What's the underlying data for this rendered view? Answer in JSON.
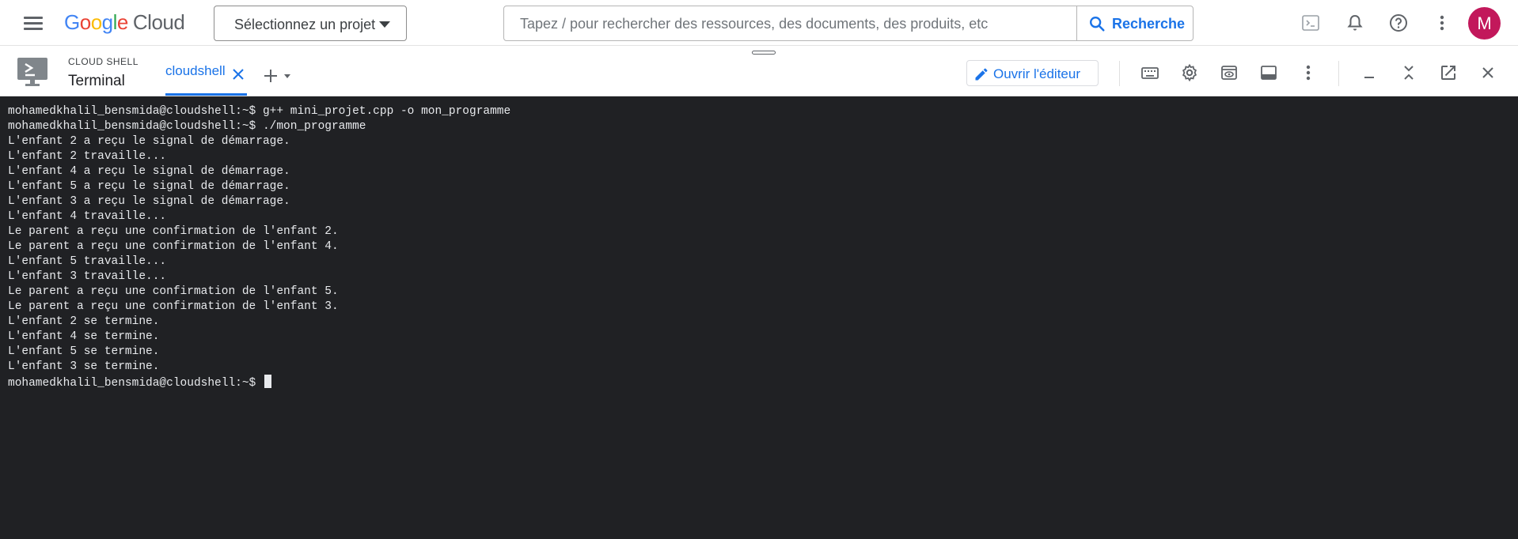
{
  "header": {
    "logo_google": "Google",
    "logo_cloud": "Cloud",
    "project_selector": "Sélectionnez un projet",
    "search_placeholder": "Tapez / pour rechercher des ressources, des documents, des produits, etc",
    "search_button": "Recherche",
    "avatar_initial": "M"
  },
  "shell": {
    "section_label": "CLOUD SHELL",
    "title": "Terminal",
    "tab_label": "cloudshell",
    "editor_button": "Ouvrir l'éditeur"
  },
  "terminal": {
    "lines": [
      "mohamedkhalil_bensmida@cloudshell:~$ g++ mini_projet.cpp -o mon_programme",
      "mohamedkhalil_bensmida@cloudshell:~$ ./mon_programme",
      "L'enfant 2 a reçu le signal de démarrage.",
      "L'enfant 2 travaille...",
      "L'enfant 4 a reçu le signal de démarrage.",
      "L'enfant 5 a reçu le signal de démarrage.",
      "L'enfant 3 a reçu le signal de démarrage.",
      "L'enfant 4 travaille...",
      "Le parent a reçu une confirmation de l'enfant 2.",
      "Le parent a reçu une confirmation de l'enfant 4.",
      "L'enfant 5 travaille...",
      "L'enfant 3 travaille...",
      "Le parent a reçu une confirmation de l'enfant 5.",
      "Le parent a reçu une confirmation de l'enfant 3.",
      "L'enfant 2 se termine.",
      "L'enfant 4 se termine.",
      "L'enfant 5 se termine.",
      "L'enfant 3 se termine."
    ],
    "prompt": "mohamedkhalil_bensmida@cloudshell:~$ "
  },
  "colors": {
    "accent": "#1a73e8",
    "terminal_bg": "#202124",
    "terminal_fg": "#e8eaed",
    "avatar_bg": "#c2185b"
  },
  "icons": [
    "menu-icon",
    "search-icon",
    "cloud-shell-icon",
    "bell-icon",
    "help-icon",
    "more-vert-icon",
    "terminal-icon",
    "close-icon",
    "plus-icon",
    "dropdown-icon",
    "pencil-icon",
    "keyboard-icon",
    "gear-icon",
    "web-preview-icon",
    "panel-icon",
    "minimize-icon",
    "collapse-icon",
    "open-new-window-icon"
  ]
}
